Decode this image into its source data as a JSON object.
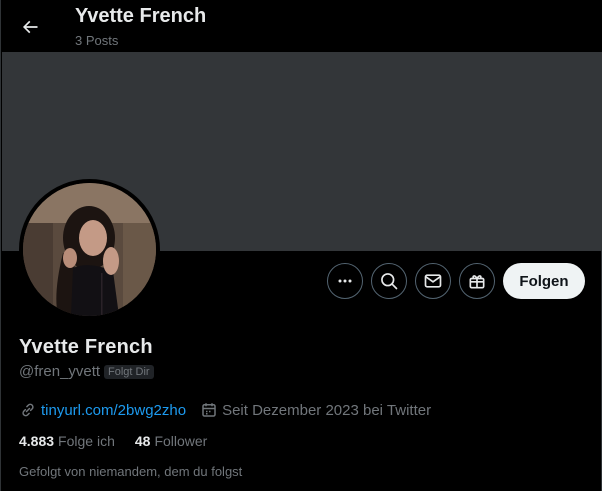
{
  "header": {
    "name": "Yvette French",
    "posts": "3 Posts"
  },
  "actions": {
    "follow_label": "Folgen"
  },
  "profile": {
    "name": "Yvette French",
    "handle": "@fren_yvett",
    "follows_you": "Folgt Dir",
    "link": "tinyurl.com/2bwg2zho",
    "joined": "Seit Dezember 2023 bei Twitter",
    "following_count": "4.883",
    "following_label": "Folge ich",
    "followers_count": "48",
    "followers_label": "Follower",
    "followed_by": "Gefolgt von niemandem, dem du folgst"
  },
  "icons": {
    "back": "arrow-left-icon",
    "more": "more-icon",
    "search": "search-icon",
    "message": "envelope-icon",
    "gift": "gift-icon",
    "link": "link-icon",
    "calendar": "calendar-icon"
  },
  "colors": {
    "background": "#000000",
    "banner": "#333639",
    "text_primary": "#e7e9ea",
    "text_secondary": "#71767b",
    "link": "#1d9bf0",
    "follow_button_bg": "#eff3f4"
  }
}
